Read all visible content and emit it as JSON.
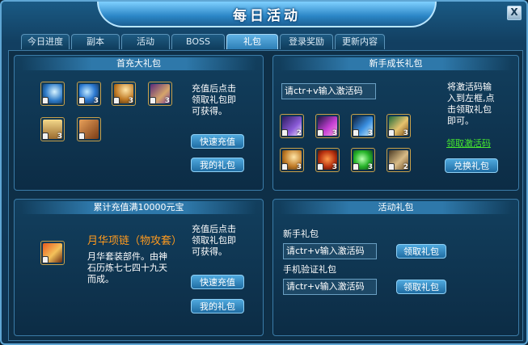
{
  "title": "每日活动",
  "close_label": "X",
  "tabs": [
    {
      "label": "今日进度"
    },
    {
      "label": "副本"
    },
    {
      "label": "活动"
    },
    {
      "label": "BOSS"
    },
    {
      "label": "礼包",
      "active": true
    },
    {
      "label": "登录奖励"
    },
    {
      "label": "更新内容"
    }
  ],
  "first_recharge": {
    "title": "首充大礼包",
    "desc_lines": [
      "充值后点击",
      "领取礼包即",
      "可获得。"
    ],
    "quick_recharge": "快速充值",
    "my_gift": "我的礼包",
    "items": [
      {
        "name": "wing-item-icon",
        "count": ""
      },
      {
        "name": "blue-orb-item-icon",
        "count": "3"
      },
      {
        "name": "golden-wing-item-icon",
        "count": "3"
      },
      {
        "name": "scroll-item-icon",
        "count": "3"
      },
      {
        "name": "chest-item-icon",
        "count": "3"
      },
      {
        "name": "bag-item-icon",
        "count": ""
      }
    ]
  },
  "newbie_growth": {
    "title": "新手成长礼包",
    "input_placeholder": "请ctr+v输入激活码",
    "desc_lines": [
      "将激活码输",
      "入到左框,点",
      "击领取礼包",
      "即可。"
    ],
    "get_code_link": "领取激活码",
    "redeem": "兑换礼包",
    "items": [
      {
        "name": "purple-crystal-item-icon",
        "count": "2"
      },
      {
        "name": "pink-sword-item-icon",
        "count": "3"
      },
      {
        "name": "blue-feather-item-icon",
        "count": "3"
      },
      {
        "name": "gold-bag-item-icon",
        "count": "3"
      },
      {
        "name": "gold-wing-item-icon",
        "count": "3"
      },
      {
        "name": "red-gem-item-icon",
        "count": "3"
      },
      {
        "name": "green-orb-item-icon",
        "count": "3"
      },
      {
        "name": "map-scroll-item-icon",
        "count": "2"
      }
    ]
  },
  "cumulative": {
    "title": "累计充值满10000元宝",
    "item_name": "月华项链（物攻套）",
    "item_desc_lines": [
      "月华套装部件。由神",
      "石历炼七七四十九天",
      "而成。"
    ],
    "desc_lines": [
      "充值后点击",
      "领取礼包即",
      "可获得。"
    ],
    "quick_recharge": "快速充值",
    "my_gift": "我的礼包"
  },
  "activity": {
    "title": "活动礼包",
    "rows": [
      {
        "label": "新手礼包",
        "placeholder": "请ctr+v输入激活码",
        "button": "领取礼包"
      },
      {
        "label": "手机验证礼包",
        "placeholder": "请ctr+v输入激活码",
        "button": "领取礼包"
      }
    ]
  }
}
